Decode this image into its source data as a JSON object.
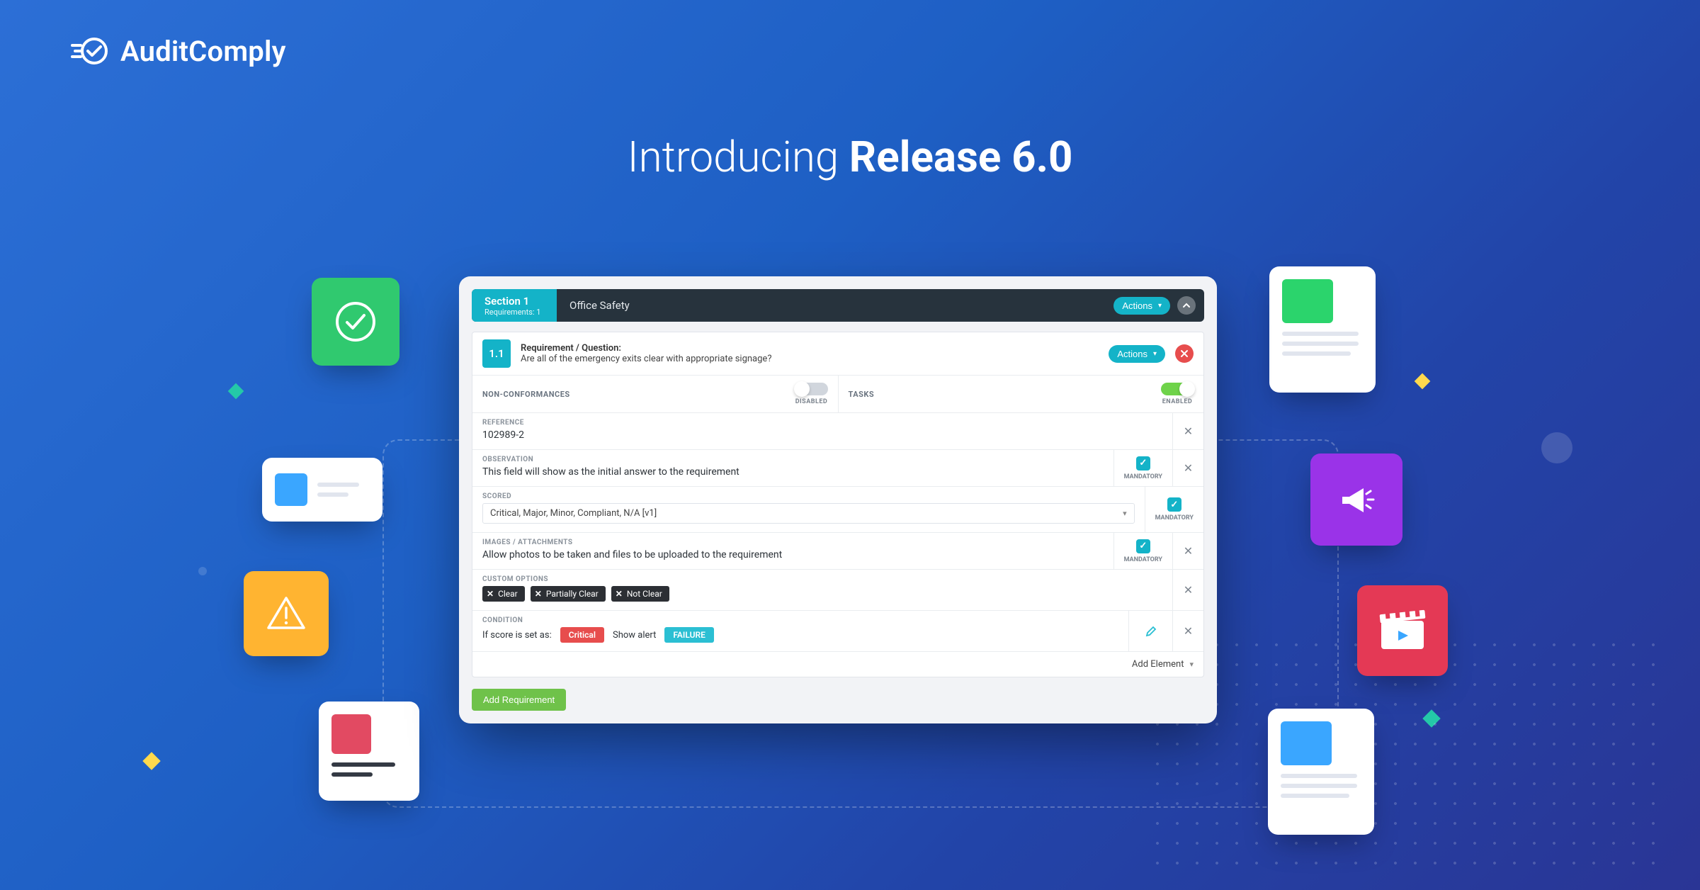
{
  "logo_text": "AuditComply",
  "hero_intro": "Introducing ",
  "hero_strong": "Release 6.0",
  "section": {
    "tab_title": "Section 1",
    "tab_sub": "Requirements: 1",
    "title": "Office Safety",
    "actions_label": "Actions"
  },
  "requirement": {
    "number": "1.1",
    "heading": "Requirement / Question:",
    "text": "Are all of the emergency exits clear with appropriate signage?",
    "actions_label": "Actions"
  },
  "toggles": {
    "nonconformances_label": "NON-CONFORMANCES",
    "nonconformances_status": "DISABLED",
    "tasks_label": "TASKS",
    "tasks_status": "ENABLED"
  },
  "fields": {
    "reference_label": "REFERENCE",
    "reference_value": "102989-2",
    "observation_label": "OBSERVATION",
    "observation_value": "This field will show as the initial answer to the requirement",
    "scored_label": "SCORED",
    "scored_value": "Critical, Major, Minor, Compliant, N/A [v1]",
    "images_label": "IMAGES / ATTACHMENTS",
    "images_value": "Allow photos to be taken and files to be uploaded to the requirement",
    "custom_label": "CUSTOM OPTIONS",
    "custom_tags": [
      "Clear",
      "Partially Clear",
      "Not Clear"
    ],
    "condition_label": "CONDITION",
    "condition_prefix": "If score is set as:",
    "condition_val": "Critical",
    "condition_mid": "Show alert",
    "condition_flag": "FAILURE",
    "mandatory_label": "MANDATORY"
  },
  "footer": {
    "add_element": "Add Element",
    "add_requirement": "Add Requirement"
  }
}
